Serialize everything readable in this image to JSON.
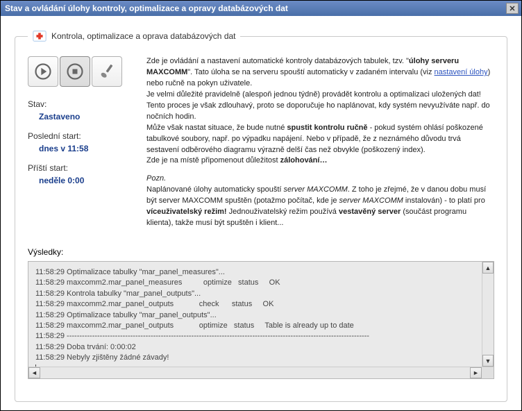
{
  "window": {
    "title": "Stav a ovládání úlohy kontroly, optimalizace a opravy databázových dat"
  },
  "group": {
    "legend": "Kontrola, optimalizace a oprava databázových dat"
  },
  "status": {
    "state_label": "Stav:",
    "state_value": "Zastaveno",
    "last_label": "Poslední start:",
    "last_value": "dnes v 11:58",
    "next_label": "Příští start:",
    "next_value": "neděle 0:00"
  },
  "desc": {
    "p1a": "Zde je ovládání a nastavení automatické kontroly databázových tabulek, tzv. \"",
    "p1b": "úlohy serveru MAXCOMM",
    "p1c": "\". Tato úloha se na serveru spouští automaticky v zadaném intervalu (viz ",
    "p1link": "nastavení úlohy",
    "p1d": ") nebo ručně na pokyn uživatele.",
    "p2": "Je velmi důležité pravidelně (alespoň jednou týdně) provádět kontrolu a optimalizaci uložených dat! Tento proces je však zdlouhavý, proto se doporučuje ho naplánovat, kdy systém nevyužíváte např. do nočních hodin.",
    "p3a": "Může však nastat situace, že bude nutné ",
    "p3b": "spustit kontrolu ručně",
    "p3c": " - pokud systém ohlásí poškozené tabulkové soubory, např. po výpadku napájení. Nebo v případě, že z neznámého důvodu trvá sestavení odběrového diagramu výrazně delší čas než obvykle (poškozený index).",
    "p4a": "Zde je na místě připomenout důležitost ",
    "p4b": "zálohování…",
    "p5": "Pozn.",
    "p6a": "Naplánované úlohy automaticky spouští ",
    "p6b": "server MAXCOMM",
    "p6c": ". Z toho je zřejmé, že v danou dobu musí být server MAXCOMM spuštěn (potažmo počítač, kde je ",
    "p6d": "server MAXCOMM",
    "p6e": " instalován) - to platí pro ",
    "p6f": "víceuživatelský režim!",
    "p6g": " Jednouživatelský režim používá ",
    "p6h": "vestavěný server",
    "p6i": " (součást programu klienta), takže musí být spuštěn i klient..."
  },
  "results": {
    "label": "Výsledky:",
    "lines": "11:58:29 Optimalizace tabulky \"mar_panel_measures\"...\n11:58:29 maxcomm2.mar_panel_measures          optimize   status     OK\n11:58:29 Kontrola tabulky \"mar_panel_outputs\"...\n11:58:29 maxcomm2.mar_panel_outputs            check      status     OK\n11:58:29 Optimalizace tabulky \"mar_panel_outputs\"...\n11:58:29 maxcomm2.mar_panel_outputs            optimize   status     Table is already up to date\n11:58:29 -----------------------------------------------------------------------------------------------------------------------\n11:58:29 Doba trvání: 0:00:02\n11:58:29 Nebyly zjištěny žádné závady!"
  }
}
